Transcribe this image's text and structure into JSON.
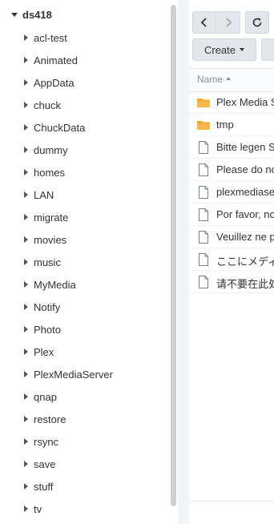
{
  "tree": {
    "root_label": "ds418",
    "items": [
      {
        "label": "acl-test"
      },
      {
        "label": "Animated"
      },
      {
        "label": "AppData"
      },
      {
        "label": "chuck"
      },
      {
        "label": "ChuckData"
      },
      {
        "label": "dummy"
      },
      {
        "label": "homes"
      },
      {
        "label": "LAN"
      },
      {
        "label": "migrate"
      },
      {
        "label": "movies"
      },
      {
        "label": "music"
      },
      {
        "label": "MyMedia"
      },
      {
        "label": "Notify"
      },
      {
        "label": "Photo"
      },
      {
        "label": "Plex"
      },
      {
        "label": "PlexMediaServer"
      },
      {
        "label": "qnap"
      },
      {
        "label": "restore"
      },
      {
        "label": "rsync"
      },
      {
        "label": "save"
      },
      {
        "label": "stuff"
      },
      {
        "label": "tv"
      }
    ]
  },
  "toolbar": {
    "back_icon": "chevron-left-icon",
    "forward_icon": "chevron-right-icon",
    "refresh_icon": "refresh-icon",
    "create_label": "Create"
  },
  "file_list": {
    "name_header": "Name",
    "rows": [
      {
        "name": "Plex Media S",
        "type": "folder"
      },
      {
        "name": "tmp",
        "type": "folder"
      },
      {
        "name": "Bitte legen S",
        "type": "file"
      },
      {
        "name": "Please do no",
        "type": "file"
      },
      {
        "name": "plexmediase",
        "type": "file"
      },
      {
        "name": "Por favor, no",
        "type": "file"
      },
      {
        "name": "Veuillez ne p",
        "type": "file"
      },
      {
        "name": "ここにメディ",
        "type": "file"
      },
      {
        "name": "请不要在此处",
        "type": "file"
      }
    ]
  },
  "colors": {
    "folder": "#f5a623",
    "button_bg": "#e3e7ec",
    "scrollbar": "#d0d0d0"
  }
}
